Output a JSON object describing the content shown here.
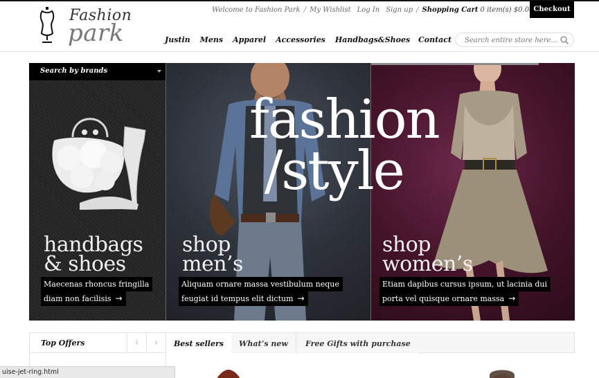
{
  "logo": {
    "line1": "Fashion",
    "line2": "park"
  },
  "top_links": {
    "welcome": "Welcome to Fashion Park",
    "wishlist": "My Wishlist",
    "login": "Log In",
    "signup": "Sign up",
    "cart_label": "Shopping Cart",
    "cart_info": "0 item(s) $0.00",
    "separator": "/",
    "checkout": "Checkout"
  },
  "nav": {
    "items": [
      "Justin",
      "Mens",
      "Apparel",
      "Accessories",
      "Handbags&Shoes"
    ],
    "contact": "Contact"
  },
  "search": {
    "placeholder": "Search entire store here..."
  },
  "hero": {
    "brand_search": "Search by brands",
    "headline_1": "fashion",
    "headline_2": "/style",
    "panels": [
      {
        "title_1": "handbags",
        "title_2": "& shoes",
        "caption_1": "Maecenas rhoncus fringilla",
        "caption_2": "diam non facilisis"
      },
      {
        "title_1": "shop",
        "title_2": "men’s",
        "caption_1": "Aliquam ornare massa vestibulum neque",
        "caption_2": "feugiat id tempus elit dictum"
      },
      {
        "title_1": "shop",
        "title_2": "women’s",
        "caption_1": "Etiam dapibus cursus ipsum, ut lacinia dui",
        "caption_2": "porta vel quisque ornare massa"
      }
    ]
  },
  "bottom": {
    "top_offers": "Top Offers",
    "tabs": [
      "Best sellers",
      "What’s new",
      "Free Gifts with purchase"
    ]
  },
  "status_bar": "uise-jet-ring.html",
  "colors": {
    "accent": "#000000",
    "hero_left": "#2b2b2b",
    "hero_mid": "#2d3139",
    "hero_right": "#431329"
  },
  "icons": [
    "mannequin-icon",
    "search-icon",
    "dropdown-caret-icon",
    "arrow-right-icon",
    "chevron-left-icon",
    "chevron-right-icon"
  ]
}
